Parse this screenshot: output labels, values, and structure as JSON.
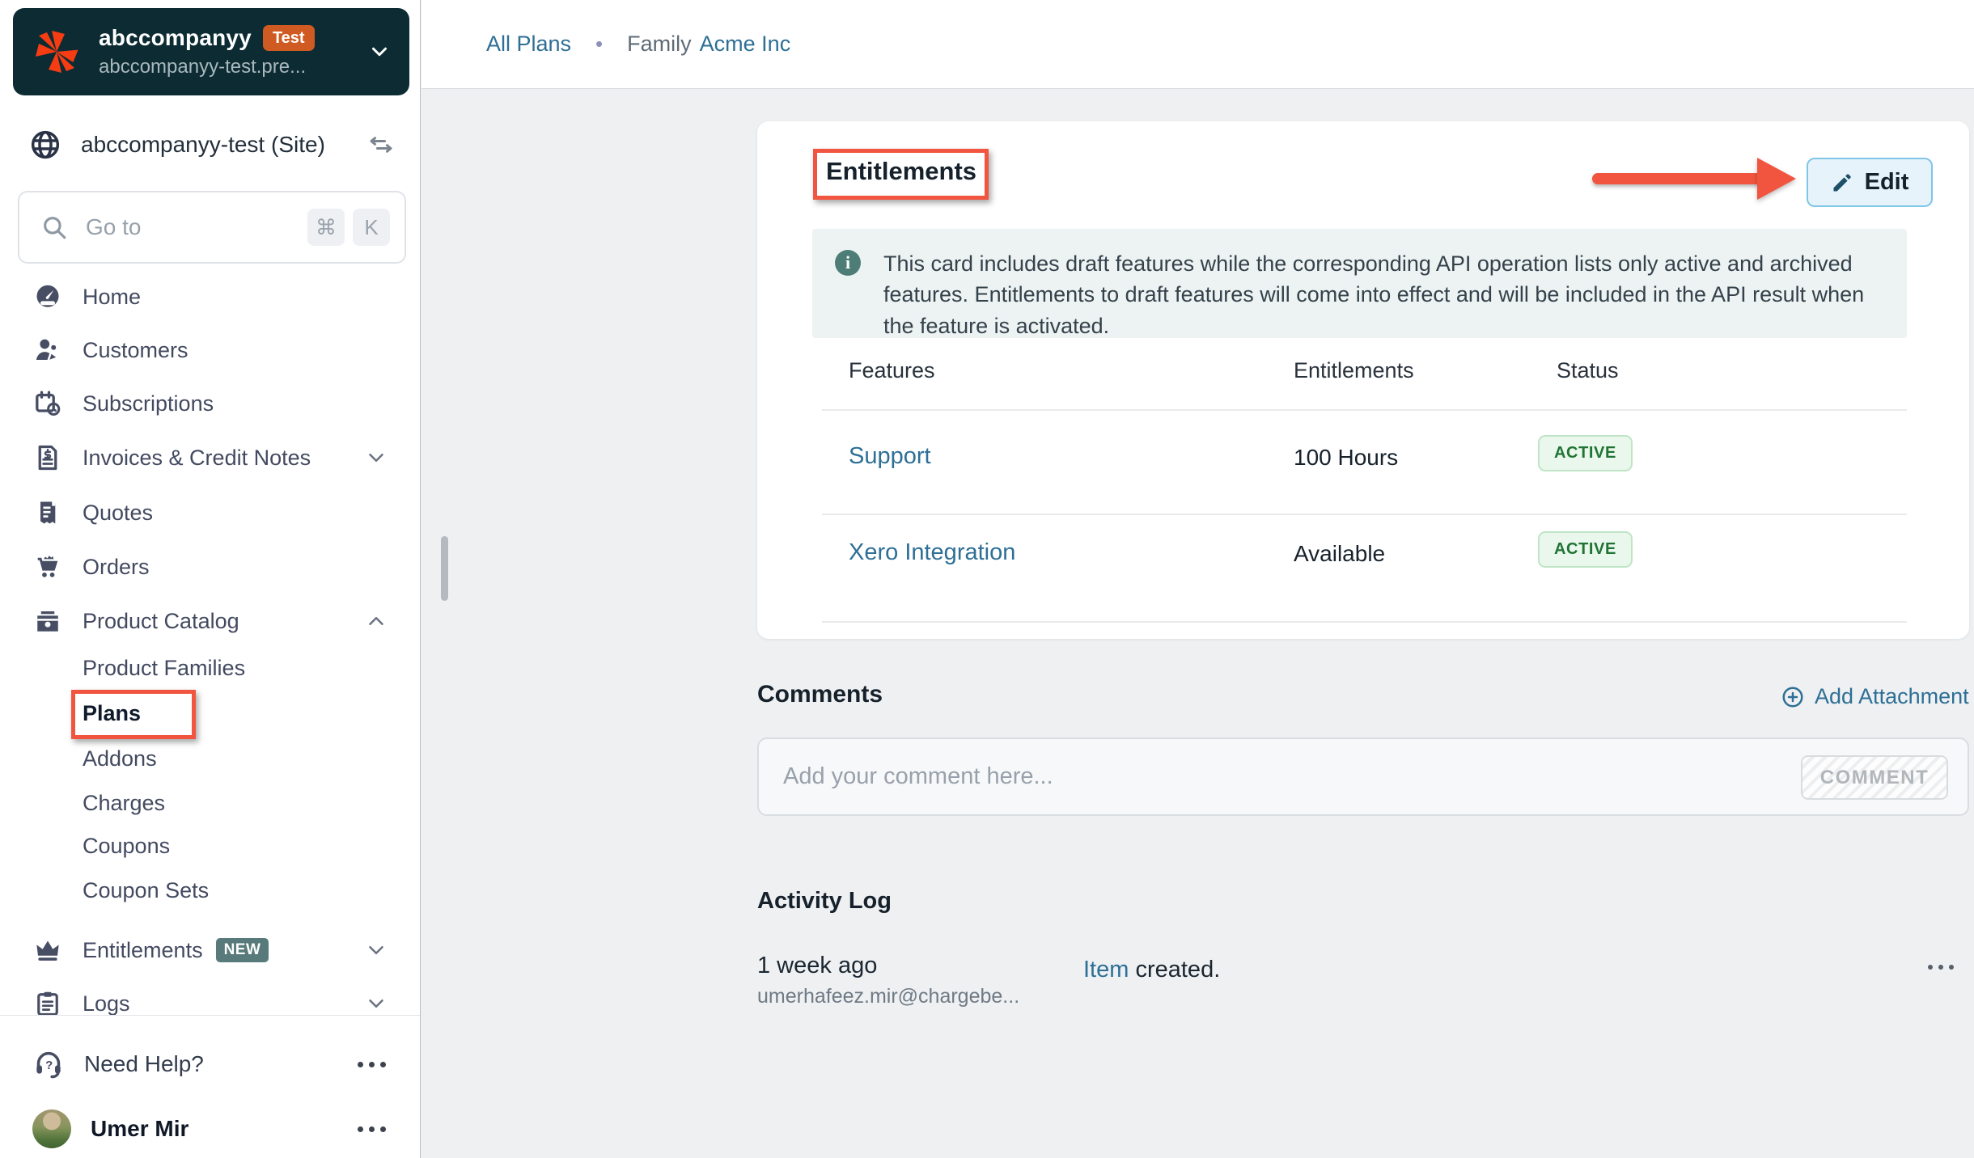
{
  "sidebar": {
    "org": {
      "name": "abccompanyy",
      "badge": "Test",
      "subdomain": "abccompanyy-test.pre..."
    },
    "site": {
      "label": "abccompanyy-test (Site)"
    },
    "search": {
      "placeholder": "Go to",
      "shortcut_mod": "⌘",
      "shortcut_key": "K"
    },
    "nav": [
      {
        "label": "Home"
      },
      {
        "label": "Customers"
      },
      {
        "label": "Subscriptions"
      },
      {
        "label": "Invoices & Credit Notes"
      },
      {
        "label": "Quotes"
      },
      {
        "label": "Orders"
      },
      {
        "label": "Product Catalog"
      }
    ],
    "subnav": [
      {
        "label": "Product Families"
      },
      {
        "label": "Plans"
      },
      {
        "label": "Addons"
      },
      {
        "label": "Charges"
      },
      {
        "label": "Coupons"
      },
      {
        "label": "Coupon Sets"
      }
    ],
    "nav_lower": [
      {
        "label": "Entitlements",
        "badge": "NEW"
      },
      {
        "label": "Logs"
      }
    ],
    "footer": {
      "help": "Need Help?",
      "user": "Umer Mir"
    }
  },
  "breadcrumb": {
    "all_plans": "All Plans",
    "separator": "•",
    "family_prefix": "Family",
    "family_link": "Acme Inc"
  },
  "entitlements_card": {
    "title": "Entitlements",
    "edit_label": "Edit",
    "banner_text": "This card includes draft features while the corresponding API operation lists only active and archived features. Entitlements to draft features will come into effect and will be included in the API result when the feature is activated.",
    "table": {
      "headers": {
        "features": "Features",
        "entitlements": "Entitlements",
        "status": "Status"
      },
      "rows": [
        {
          "feature": "Support",
          "entitlement": "100 Hours",
          "status": "ACTIVE"
        },
        {
          "feature": "Xero Integration",
          "entitlement": "Available",
          "status": "ACTIVE"
        }
      ]
    }
  },
  "comments": {
    "title": "Comments",
    "add_attachment": "Add Attachment",
    "placeholder": "Add your comment here...",
    "button": "COMMENT"
  },
  "activity_log": {
    "title": "Activity Log",
    "entries": [
      {
        "time": "1 week ago",
        "actor": "umerhafeez.mir@chargebe...",
        "action_link": "Item",
        "action_rest": " created."
      }
    ]
  },
  "colors": {
    "annotation_red": "#f1553f",
    "link_blue": "#2e6f96",
    "active_green_text": "#1f7434",
    "active_green_bg": "#eaf7ec",
    "header_dark": "#0c2b33",
    "brand_orange": "#f63c12"
  }
}
